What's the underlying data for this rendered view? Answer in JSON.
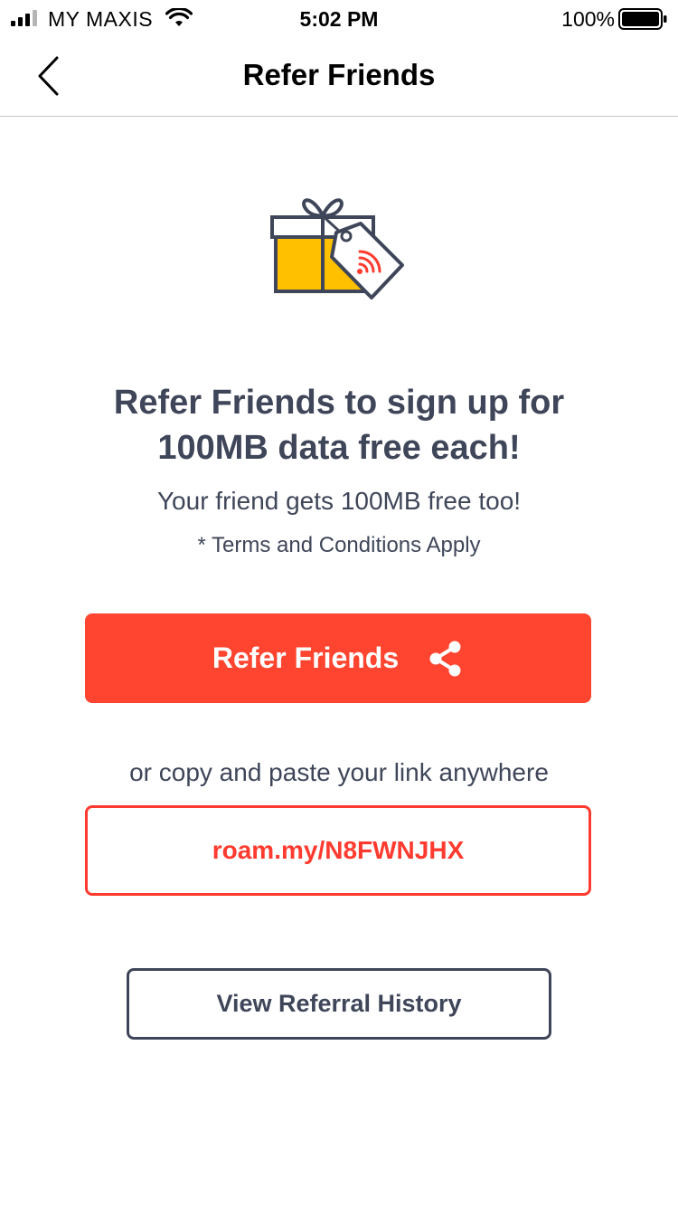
{
  "status_bar": {
    "carrier": "MY MAXIS",
    "time": "5:02 PM",
    "battery": "100%",
    "icons": [
      "signal-icon",
      "wifi-icon",
      "battery-icon"
    ]
  },
  "nav": {
    "title": "Refer Friends",
    "back_icon": "chevron-left-icon"
  },
  "hero": {
    "icon": "gift-tag-icon",
    "headline": "Refer Friends to sign up for 100MB data free each!",
    "subtext": "Your friend gets 100MB free too!",
    "terms": "* Terms and Conditions Apply"
  },
  "actions": {
    "refer_button_label": "Refer Friends",
    "refer_button_icon": "share-icon",
    "copy_hint": "or copy and paste your link anywhere",
    "referral_link": "roam.my/N8FWNJHX",
    "history_button_label": "View Referral History"
  },
  "colors": {
    "accent": "#ff4530",
    "text": "#3f4659",
    "gift": "#ffc000",
    "link": "#ff3b30"
  }
}
